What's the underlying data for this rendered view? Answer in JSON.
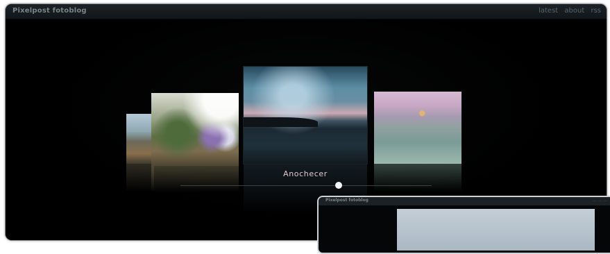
{
  "header": {
    "site_title": "Pixelpost fotoblog",
    "nav": [
      "latest",
      "about",
      "rss"
    ]
  },
  "gallery": {
    "caption": "Anochecer",
    "slider_position": 0.63
  },
  "secondary_window": {
    "site_title": "Pixelpost fotoblog",
    "nav": "... ... ..."
  }
}
